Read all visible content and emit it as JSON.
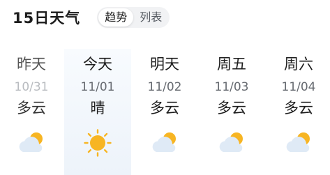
{
  "header": {
    "title": "15日天气",
    "tabs": [
      {
        "label": "趋势",
        "active": true
      },
      {
        "label": "列表",
        "active": false
      }
    ]
  },
  "days": [
    {
      "name": "昨天",
      "date": "10/31",
      "weather": "多云",
      "icon": "partly-cloudy-icon",
      "past": true
    },
    {
      "name": "今天",
      "date": "11/01",
      "weather": "晴",
      "icon": "sun-icon",
      "today": true
    },
    {
      "name": "明天",
      "date": "11/02",
      "weather": "多云",
      "icon": "partly-cloudy-icon"
    },
    {
      "name": "周五",
      "date": "11/03",
      "weather": "多云",
      "icon": "partly-cloudy-icon"
    },
    {
      "name": "周六",
      "date": "11/04",
      "weather": "多云",
      "icon": "partly-cloudy-icon"
    }
  ],
  "colors": {
    "sun": "#f7b523",
    "cloud": "#dfeaf6",
    "today_highlight": "#eef4fb"
  }
}
